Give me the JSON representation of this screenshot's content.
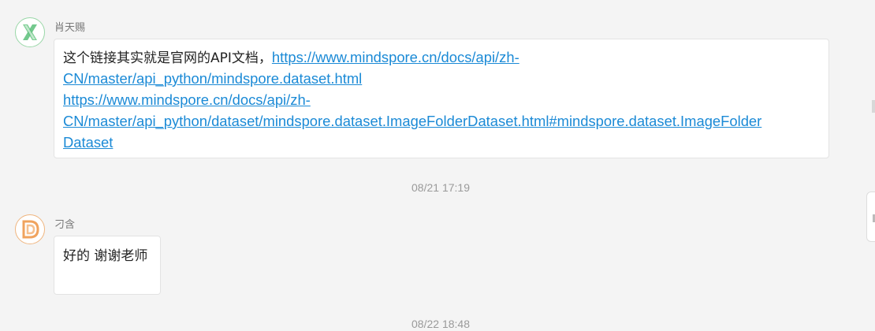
{
  "messages": [
    {
      "sender": "肖天赐",
      "avatar_letter": "X",
      "avatar_icon": "letter-x-avatar-icon",
      "accent": "#5cbf7a",
      "text": "这个链接其实就是官网的API文档，",
      "links": [
        {
          "line1": "https://www.mindspore.cn/docs/api/zh-",
          "line2": "CN/master/api_python/mindspore.dataset.html"
        },
        {
          "line1": "https://www.mindspore.cn/docs/api/zh-",
          "line2": "CN/master/api_python/dataset/mindspore.dataset.ImageFolderDataset.html#mindspore.dataset.ImageFolder",
          "line3": "Dataset"
        }
      ]
    },
    {
      "sender": "刁含",
      "avatar_letter": "D",
      "avatar_icon": "letter-d-avatar-icon",
      "accent": "#f0a35e",
      "text": "好的 谢谢老师"
    }
  ],
  "timestamps": [
    "08/21 17:19",
    "08/22 18:48"
  ],
  "colors": {
    "background": "#f4f4f4",
    "link": "#1b8ad6",
    "timestamp": "#9a9a9a"
  }
}
